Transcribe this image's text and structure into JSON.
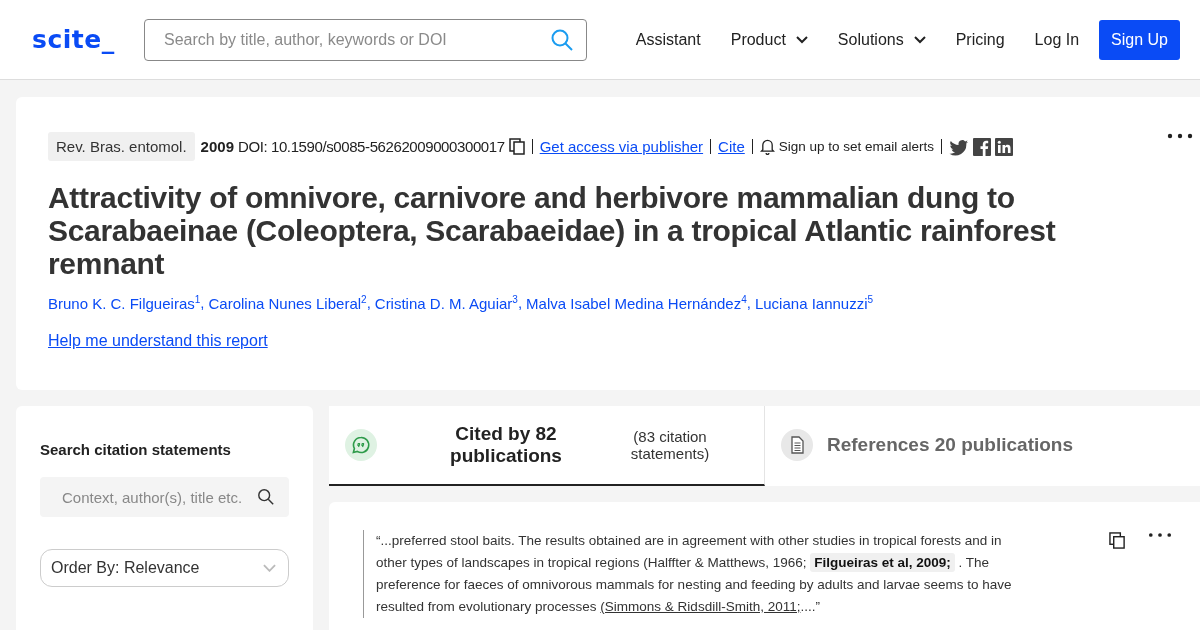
{
  "header": {
    "logo": "scite_",
    "search": {
      "placeholder": "Search by title, author, keywords or DOI"
    },
    "nav": [
      {
        "label": "Assistant",
        "kind": "link"
      },
      {
        "label": "Product",
        "kind": "dropdown"
      },
      {
        "label": "Solutions",
        "kind": "dropdown"
      },
      {
        "label": "Pricing",
        "kind": "link"
      },
      {
        "label": "Log In",
        "kind": "link"
      },
      {
        "label": "Sign Up",
        "kind": "primary"
      }
    ]
  },
  "article": {
    "journal": "Rev. Bras. entomol.",
    "year": "2009",
    "doi": "DOI: 10.1590/s0085-56262009000300017",
    "access_link": "Get access via publisher",
    "cite_link": "Cite",
    "alerts": "Sign up to set email alerts",
    "title": "Attractivity of omnivore, carnivore and herbivore mammalian dung to Scarabaeinae (Coleoptera, Scarabaeidae) in a tropical Atlantic rainforest remnant",
    "author_separator": ",",
    "authors": [
      "Bruno K. C. Filgueiras$^{1}$",
      "Carolina Nunes Liberal$^{2}$",
      "Cristina D. M. Aguiar$^{3}$",
      "Malva Isabel Medina Hernández$^{4}$",
      "Luciana Iannuzzi$^{5}$"
    ],
    "help_link": "Help me understand this report"
  },
  "sidebar": {
    "heading": "Search citation statements",
    "search": {
      "placeholder": "Context, author(s), title etc."
    },
    "order": "Order By: Relevance"
  },
  "tabs": [
    {
      "kind": "cited",
      "label": "Cited by 82 publications",
      "note": "(83 citation statements)",
      "selected": true
    },
    {
      "kind": "references",
      "label": "References 20 publications",
      "selected": false
    }
  ],
  "statement": {
    "parts": [
      {
        "kind": "text",
        "text": "“...preferred stool baits. The results obtained are in agreement with other studies in tropical forests and in other types of landscapes in tropical regions (Halffter & Matthews, 1966; "
      },
      {
        "kind": "highlight",
        "text": "Filgueiras et al, 2009;"
      },
      {
        "kind": "text",
        "text": " . The preference for faeces of omnivorous mammals for nesting and feeding by adults and larvae seems to have resulted from evolutionary processes "
      },
      {
        "kind": "link",
        "text": "(Simmons & Ridsdill-Smith, 2011;"
      },
      {
        "kind": "text",
        "text": "....”"
      }
    ]
  }
}
